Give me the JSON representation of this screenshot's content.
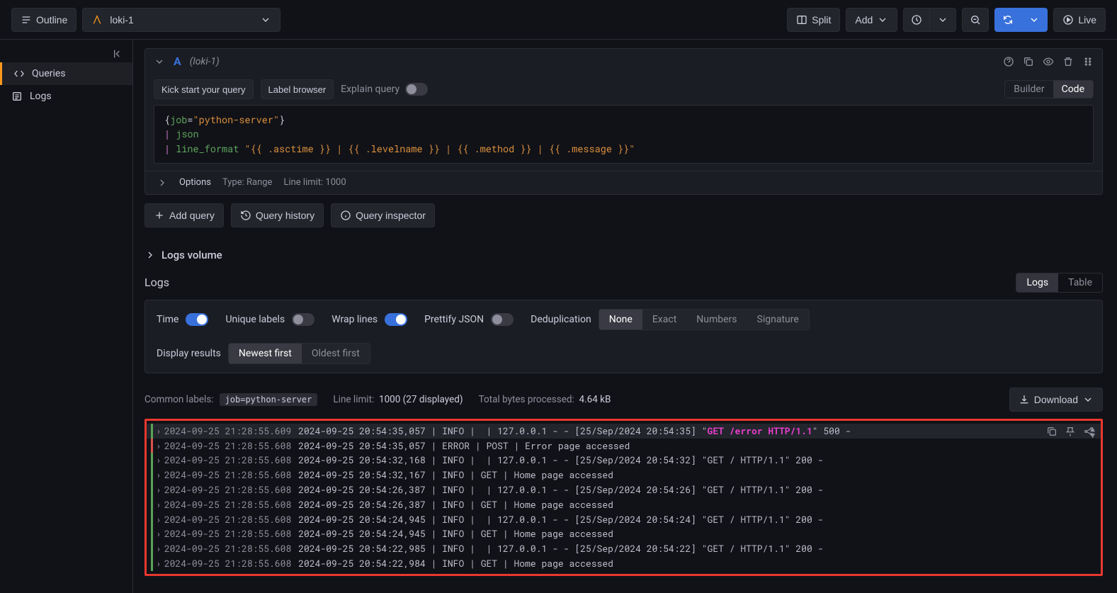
{
  "topbar": {
    "outline": "Outline",
    "datasource": "loki-1",
    "split": "Split",
    "add": "Add",
    "live": "Live"
  },
  "sidebar": {
    "items": [
      {
        "label": "Queries",
        "active": true
      },
      {
        "label": "Logs",
        "active": false
      }
    ]
  },
  "query": {
    "letter": "A",
    "ds_hint": "(loki-1)",
    "kickstart": "Kick start your query",
    "label_browser": "Label browser",
    "explain": "Explain query",
    "builder": "Builder",
    "code": "Code",
    "code_text": {
      "l1_pre": "{",
      "l1_key": "job",
      "l1_eq": "=",
      "l1_val": "\"python-server\"",
      "l1_post": "}",
      "l2_pipe": "|",
      "l2_fn": "json",
      "l3_pipe": "|",
      "l3_fn": "line_format",
      "l3_str": "\"{{ .asctime }} | {{ .levelname }} | {{ .method }} | {{ .message }}\""
    },
    "options_label": "Options",
    "type_label": "Type: Range",
    "line_limit_label": "Line limit: 1000"
  },
  "actions": {
    "add_query": "Add query",
    "query_history": "Query history",
    "query_inspector": "Query inspector"
  },
  "logs_volume": "Logs volume",
  "logs_section": {
    "title": "Logs",
    "view_logs": "Logs",
    "view_table": "Table"
  },
  "controls": {
    "time": "Time",
    "unique_labels": "Unique labels",
    "wrap_lines": "Wrap lines",
    "prettify_json": "Prettify JSON",
    "dedup": "Deduplication",
    "dedup_options": [
      "None",
      "Exact",
      "Numbers",
      "Signature"
    ],
    "display_results": "Display results",
    "order_options": [
      "Newest first",
      "Oldest first"
    ]
  },
  "meta": {
    "common_labels": "Common labels:",
    "label_chip": "job=python-server",
    "line_limit": "Line limit:",
    "line_limit_val": "1000 (27 displayed)",
    "bytes": "Total bytes processed:",
    "bytes_val": "4.64 kB",
    "download": "Download"
  },
  "log_rows": [
    {
      "lvl": "info",
      "ts": "2024-09-25 21:28:55.609",
      "msg_pre": "2024-09-25 20:54:35,057 | INFO |  | 127.0.0.1 - - [25/Sep/2024 20:54:35] \"",
      "hl": "GET /error HTTP/1.1",
      "msg_post": "\" 500 -",
      "hover": true
    },
    {
      "lvl": "error",
      "ts": "2024-09-25 21:28:55.608",
      "msg_pre": "2024-09-25 20:54:35,057 | ERROR | POST | Error page accessed",
      "hl": "",
      "msg_post": ""
    },
    {
      "lvl": "info",
      "ts": "2024-09-25 21:28:55.608",
      "msg_pre": "2024-09-25 20:54:32,168 | INFO |  | 127.0.0.1 - - [25/Sep/2024 20:54:32] \"GET / HTTP/1.1\" 200 -",
      "hl": "",
      "msg_post": ""
    },
    {
      "lvl": "info",
      "ts": "2024-09-25 21:28:55.608",
      "msg_pre": "2024-09-25 20:54:32,167 | INFO | GET | Home page accessed",
      "hl": "",
      "msg_post": ""
    },
    {
      "lvl": "info",
      "ts": "2024-09-25 21:28:55.608",
      "msg_pre": "2024-09-25 20:54:26,387 | INFO |  | 127.0.0.1 - - [25/Sep/2024 20:54:26] \"GET / HTTP/1.1\" 200 -",
      "hl": "",
      "msg_post": ""
    },
    {
      "lvl": "info",
      "ts": "2024-09-25 21:28:55.608",
      "msg_pre": "2024-09-25 20:54:26,387 | INFO | GET | Home page accessed",
      "hl": "",
      "msg_post": ""
    },
    {
      "lvl": "info",
      "ts": "2024-09-25 21:28:55.608",
      "msg_pre": "2024-09-25 20:54:24,945 | INFO |  | 127.0.0.1 - - [25/Sep/2024 20:54:24] \"GET / HTTP/1.1\" 200 -",
      "hl": "",
      "msg_post": ""
    },
    {
      "lvl": "info",
      "ts": "2024-09-25 21:28:55.608",
      "msg_pre": "2024-09-25 20:54:24,945 | INFO | GET | Home page accessed",
      "hl": "",
      "msg_post": ""
    },
    {
      "lvl": "info",
      "ts": "2024-09-25 21:28:55.608",
      "msg_pre": "2024-09-25 20:54:22,985 | INFO |  | 127.0.0.1 - - [25/Sep/2024 20:54:22] \"GET / HTTP/1.1\" 200 -",
      "hl": "",
      "msg_post": ""
    },
    {
      "lvl": "info",
      "ts": "2024-09-25 21:28:55.608",
      "msg_pre": "2024-09-25 20:54:22,984 | INFO | GET | Home page accessed",
      "hl": "",
      "msg_post": ""
    }
  ]
}
